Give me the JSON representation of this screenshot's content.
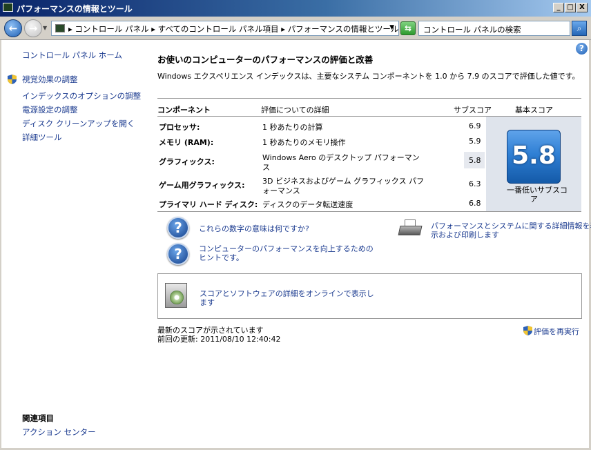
{
  "window": {
    "title": "パフォーマンスの情報とツール",
    "minimize": "_",
    "maximize": "□",
    "close": "X"
  },
  "address": {
    "sep": "▾",
    "path": "▸ コントロール パネル ▸ すべてのコントロール パネル項目 ▸ パフォーマンスの情報とツール",
    "dropdown": "▼",
    "refresh": "⇆",
    "search_text": "コントロール パネルの検索",
    "search_btn": "⌕"
  },
  "sidebar": {
    "home": "コントロール パネル ホーム",
    "items": [
      "視覚効果の調整",
      "インデックスのオプションの調整",
      "電源設定の調整",
      "ディスク クリーンアップを開く",
      "詳細ツール"
    ],
    "related_heading": "関連項目",
    "related": [
      "アクション センター"
    ]
  },
  "main": {
    "heading": "お使いのコンピューターのパフォーマンスの評価と改善",
    "description": "Windows エクスペリエンス インデックスは、主要なシステム コンポーネントを 1.0 から 7.9 のスコアで評価した値です。",
    "columns": {
      "component": "コンポーネント",
      "details": "評価についての詳細",
      "subscore": "サブスコア",
      "basescore": "基本スコア"
    },
    "rows": [
      {
        "component": "プロセッサ:",
        "detail": "1 秒あたりの計算",
        "detail2": "",
        "subscore": "6.9"
      },
      {
        "component": "メモリ (RAM):",
        "detail": "1 秒あたりのメモリ操作",
        "detail2": "",
        "subscore": "5.9"
      },
      {
        "component": "グラフィックス:",
        "detail": "Windows Aero のデスクトップ パフォーマン",
        "detail2": "ス",
        "subscore": "5.8"
      },
      {
        "component": "ゲーム用グラフィックス:",
        "detail": "3D ビジネスおよびゲーム グラフィックス パフ",
        "detail2": "ォーマンス",
        "subscore": "6.3"
      },
      {
        "component": "プライマリ ハード ディスク:",
        "detail": "ディスクのデータ転送速度",
        "detail2": "",
        "subscore": "6.8"
      }
    ],
    "base_score": "5.8",
    "base_caption_1": "一番低いサブスコ",
    "base_caption_2": "ア",
    "help_links": [
      {
        "line1": "これらの数字の意味は何ですか?",
        "line2": ""
      },
      {
        "line1": "コンピューターのパフォーマンスを向上するための",
        "line2": "ヒントです。"
      }
    ],
    "print_link_1": "パフォーマンスとシステムに関する詳細情報を表",
    "print_link_2": "示および印刷します",
    "online_1": "スコアとソフトウェアの詳細をオンラインで表示し",
    "online_2": "ます",
    "status_1": "最新のスコアが示されています",
    "status_2": "前回の更新: 2011/08/10 12:40:42",
    "rerun": "評価を再実行",
    "help_icon": "?"
  }
}
